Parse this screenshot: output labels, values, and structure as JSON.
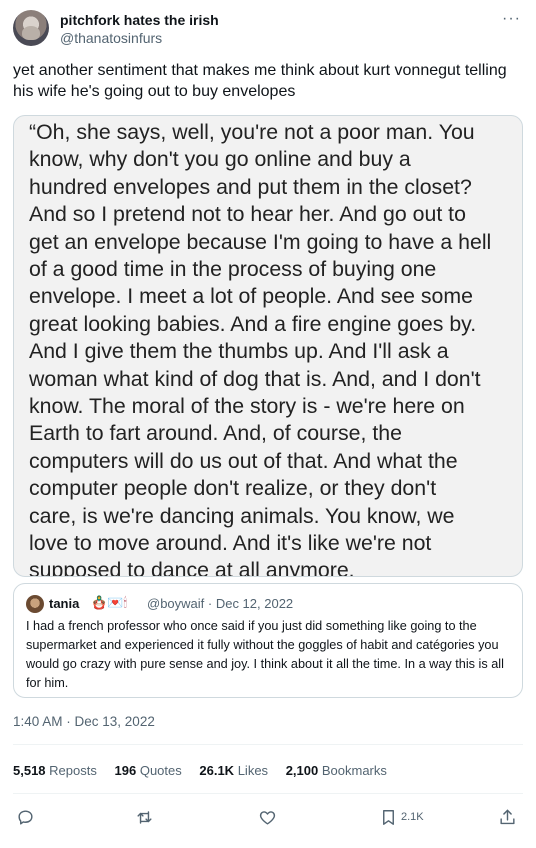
{
  "author": {
    "name": "pitchfork hates the irish",
    "handle": "@thanatosinfurs"
  },
  "more_label": "···",
  "tweet_text": "yet another sentiment that makes me think about kurt vonnegut telling his wife he's going out to buy envelopes",
  "image_text_lines": [
    "“Oh, she says, well, you're not a poor man. You",
    "know, why don't you go online and buy a",
    "hundred envelopes and put them in the closet?",
    "And so I pretend not to hear her. And go out to",
    "get an envelope because I'm going to have a hell",
    "of a good time in the process of buying one",
    "envelope. I meet a lot of people. And see some",
    "great looking babies. And a fire engine goes by.",
    "And I give them the thumbs up. And I'll ask a",
    "woman what kind of dog that is. And, and I don't",
    "know. The moral of the story is - we're here on",
    "Earth to fart around. And, of course, the",
    "computers will do us out of that. And what the",
    "computer people don't realize, or they don't",
    "care, is we're dancing animals. You know, we",
    "love to move around. And it's like we're not",
    "supposed to dance at all anymore."
  ],
  "quoted_tweet": {
    "name": "tania",
    "emojis": "🪆💌🕯",
    "handle_date": "@boywaif · Dec 12, 2022",
    "text": "I had a french professor who once said if you just did something like going to the supermarket and experienced it fully without the goggles of habit and catégories you would go crazy with pure sense and joy. I think about it all the time. In a way this is all for him."
  },
  "timestamp": "1:40 AM · Dec 13, 2022",
  "stats": {
    "reposts_count": "5,518",
    "reposts_label": "Reposts",
    "quotes_count": "196",
    "quotes_label": "Quotes",
    "likes_count": "26.1K",
    "likes_label": "Likes",
    "bookmarks_count": "2,100",
    "bookmarks_label": "Bookmarks"
  },
  "actions": {
    "reply_icon": "reply-icon",
    "repost_icon": "repost-icon",
    "like_icon": "heart-icon",
    "bookmark_icon": "bookmark-icon",
    "bookmark_count": "2.1K",
    "share_icon": "share-icon"
  },
  "colors": {
    "text": "#0f1419",
    "muted": "#536471",
    "border": "#cfd9de",
    "image_bg": "#f2f2f2"
  }
}
